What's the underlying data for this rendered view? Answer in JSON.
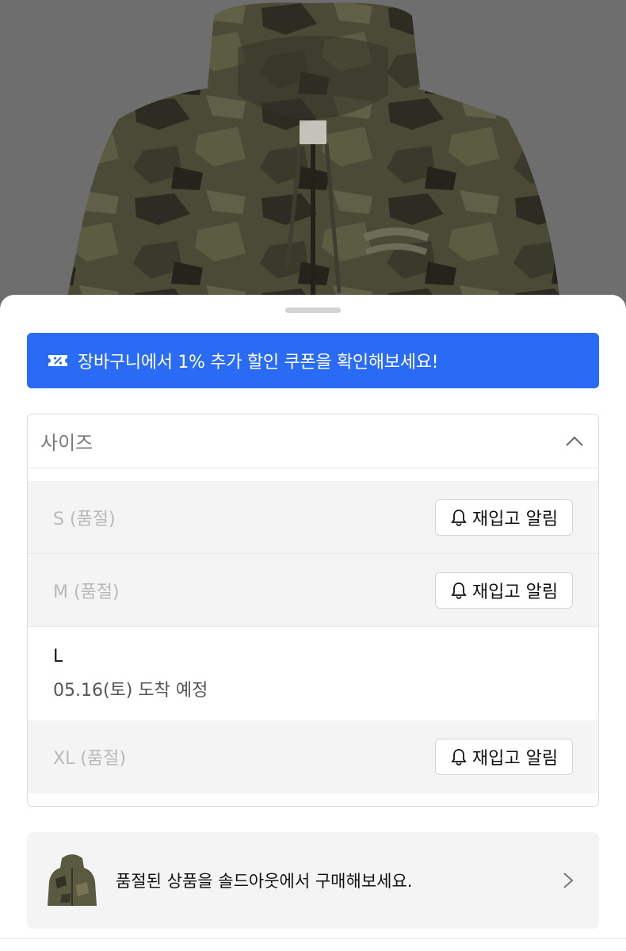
{
  "banner": {
    "text": "장바구니에서 1% 추가 할인 쿠폰을 확인해보세요!",
    "color": "#2a6bf5",
    "icon": "coupon-icon"
  },
  "size_selector": {
    "label": "사이즈",
    "expanded": true,
    "options": [
      {
        "label": "S (품절)",
        "sold_out": true,
        "restock_label": "재입고 알림"
      },
      {
        "label": "M (품절)",
        "sold_out": true,
        "restock_label": "재입고 알림"
      },
      {
        "label": "L",
        "sold_out": false,
        "eta": "05.16(토) 도착 예정"
      },
      {
        "label": "XL (품절)",
        "sold_out": true,
        "restock_label": "재입고 알림"
      }
    ]
  },
  "soldout_promo": {
    "text": "품절된 상품을 솔드아웃에서 구매해보세요."
  }
}
